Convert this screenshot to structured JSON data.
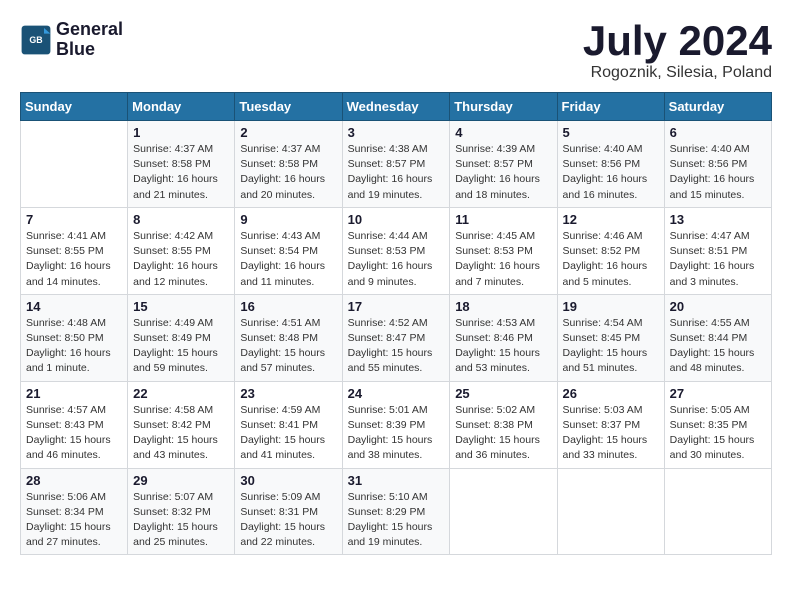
{
  "header": {
    "logo_line1": "General",
    "logo_line2": "Blue",
    "title": "July 2024",
    "location": "Rogoznik, Silesia, Poland"
  },
  "days_of_week": [
    "Sunday",
    "Monday",
    "Tuesday",
    "Wednesday",
    "Thursday",
    "Friday",
    "Saturday"
  ],
  "weeks": [
    [
      {
        "num": "",
        "info": ""
      },
      {
        "num": "1",
        "info": "Sunrise: 4:37 AM\nSunset: 8:58 PM\nDaylight: 16 hours\nand 21 minutes."
      },
      {
        "num": "2",
        "info": "Sunrise: 4:37 AM\nSunset: 8:58 PM\nDaylight: 16 hours\nand 20 minutes."
      },
      {
        "num": "3",
        "info": "Sunrise: 4:38 AM\nSunset: 8:57 PM\nDaylight: 16 hours\nand 19 minutes."
      },
      {
        "num": "4",
        "info": "Sunrise: 4:39 AM\nSunset: 8:57 PM\nDaylight: 16 hours\nand 18 minutes."
      },
      {
        "num": "5",
        "info": "Sunrise: 4:40 AM\nSunset: 8:56 PM\nDaylight: 16 hours\nand 16 minutes."
      },
      {
        "num": "6",
        "info": "Sunrise: 4:40 AM\nSunset: 8:56 PM\nDaylight: 16 hours\nand 15 minutes."
      }
    ],
    [
      {
        "num": "7",
        "info": "Sunrise: 4:41 AM\nSunset: 8:55 PM\nDaylight: 16 hours\nand 14 minutes."
      },
      {
        "num": "8",
        "info": "Sunrise: 4:42 AM\nSunset: 8:55 PM\nDaylight: 16 hours\nand 12 minutes."
      },
      {
        "num": "9",
        "info": "Sunrise: 4:43 AM\nSunset: 8:54 PM\nDaylight: 16 hours\nand 11 minutes."
      },
      {
        "num": "10",
        "info": "Sunrise: 4:44 AM\nSunset: 8:53 PM\nDaylight: 16 hours\nand 9 minutes."
      },
      {
        "num": "11",
        "info": "Sunrise: 4:45 AM\nSunset: 8:53 PM\nDaylight: 16 hours\nand 7 minutes."
      },
      {
        "num": "12",
        "info": "Sunrise: 4:46 AM\nSunset: 8:52 PM\nDaylight: 16 hours\nand 5 minutes."
      },
      {
        "num": "13",
        "info": "Sunrise: 4:47 AM\nSunset: 8:51 PM\nDaylight: 16 hours\nand 3 minutes."
      }
    ],
    [
      {
        "num": "14",
        "info": "Sunrise: 4:48 AM\nSunset: 8:50 PM\nDaylight: 16 hours\nand 1 minute."
      },
      {
        "num": "15",
        "info": "Sunrise: 4:49 AM\nSunset: 8:49 PM\nDaylight: 15 hours\nand 59 minutes."
      },
      {
        "num": "16",
        "info": "Sunrise: 4:51 AM\nSunset: 8:48 PM\nDaylight: 15 hours\nand 57 minutes."
      },
      {
        "num": "17",
        "info": "Sunrise: 4:52 AM\nSunset: 8:47 PM\nDaylight: 15 hours\nand 55 minutes."
      },
      {
        "num": "18",
        "info": "Sunrise: 4:53 AM\nSunset: 8:46 PM\nDaylight: 15 hours\nand 53 minutes."
      },
      {
        "num": "19",
        "info": "Sunrise: 4:54 AM\nSunset: 8:45 PM\nDaylight: 15 hours\nand 51 minutes."
      },
      {
        "num": "20",
        "info": "Sunrise: 4:55 AM\nSunset: 8:44 PM\nDaylight: 15 hours\nand 48 minutes."
      }
    ],
    [
      {
        "num": "21",
        "info": "Sunrise: 4:57 AM\nSunset: 8:43 PM\nDaylight: 15 hours\nand 46 minutes."
      },
      {
        "num": "22",
        "info": "Sunrise: 4:58 AM\nSunset: 8:42 PM\nDaylight: 15 hours\nand 43 minutes."
      },
      {
        "num": "23",
        "info": "Sunrise: 4:59 AM\nSunset: 8:41 PM\nDaylight: 15 hours\nand 41 minutes."
      },
      {
        "num": "24",
        "info": "Sunrise: 5:01 AM\nSunset: 8:39 PM\nDaylight: 15 hours\nand 38 minutes."
      },
      {
        "num": "25",
        "info": "Sunrise: 5:02 AM\nSunset: 8:38 PM\nDaylight: 15 hours\nand 36 minutes."
      },
      {
        "num": "26",
        "info": "Sunrise: 5:03 AM\nSunset: 8:37 PM\nDaylight: 15 hours\nand 33 minutes."
      },
      {
        "num": "27",
        "info": "Sunrise: 5:05 AM\nSunset: 8:35 PM\nDaylight: 15 hours\nand 30 minutes."
      }
    ],
    [
      {
        "num": "28",
        "info": "Sunrise: 5:06 AM\nSunset: 8:34 PM\nDaylight: 15 hours\nand 27 minutes."
      },
      {
        "num": "29",
        "info": "Sunrise: 5:07 AM\nSunset: 8:32 PM\nDaylight: 15 hours\nand 25 minutes."
      },
      {
        "num": "30",
        "info": "Sunrise: 5:09 AM\nSunset: 8:31 PM\nDaylight: 15 hours\nand 22 minutes."
      },
      {
        "num": "31",
        "info": "Sunrise: 5:10 AM\nSunset: 8:29 PM\nDaylight: 15 hours\nand 19 minutes."
      },
      {
        "num": "",
        "info": ""
      },
      {
        "num": "",
        "info": ""
      },
      {
        "num": "",
        "info": ""
      }
    ]
  ]
}
